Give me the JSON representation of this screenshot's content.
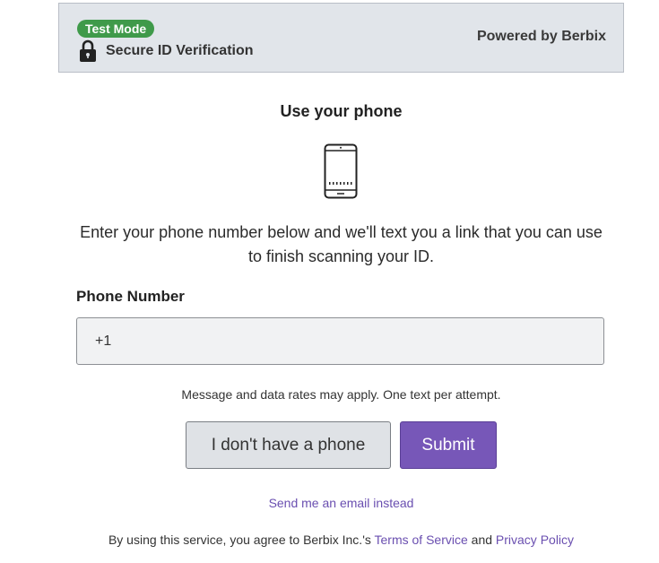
{
  "header": {
    "badge": "Test Mode",
    "secure_label": "Secure ID Verification",
    "powered_by": "Powered by Berbix",
    "lock_icon": "lock-icon"
  },
  "main": {
    "title": "Use your phone",
    "phone_icon": "smartphone-icon",
    "instructions": "Enter your phone number below and we'll text you a link that you can use to finish scanning your ID.",
    "phone_label": "Phone Number",
    "phone_value": "+1",
    "disclaimer": "Message and data rates may apply. One text per attempt.",
    "no_phone_button": "I don't have a phone",
    "submit_button": "Submit",
    "email_link": "Send me an email instead"
  },
  "footer": {
    "prefix": "By using this service, you agree to Berbix Inc.'s",
    "terms_link": "Terms of Service",
    "conjunction": "and",
    "privacy_link": "Privacy Policy"
  },
  "colors": {
    "badge": "#3f9a4a",
    "primary": "#7757b8",
    "link": "#6a4fb0",
    "header_bg": "#e1e5ea"
  }
}
